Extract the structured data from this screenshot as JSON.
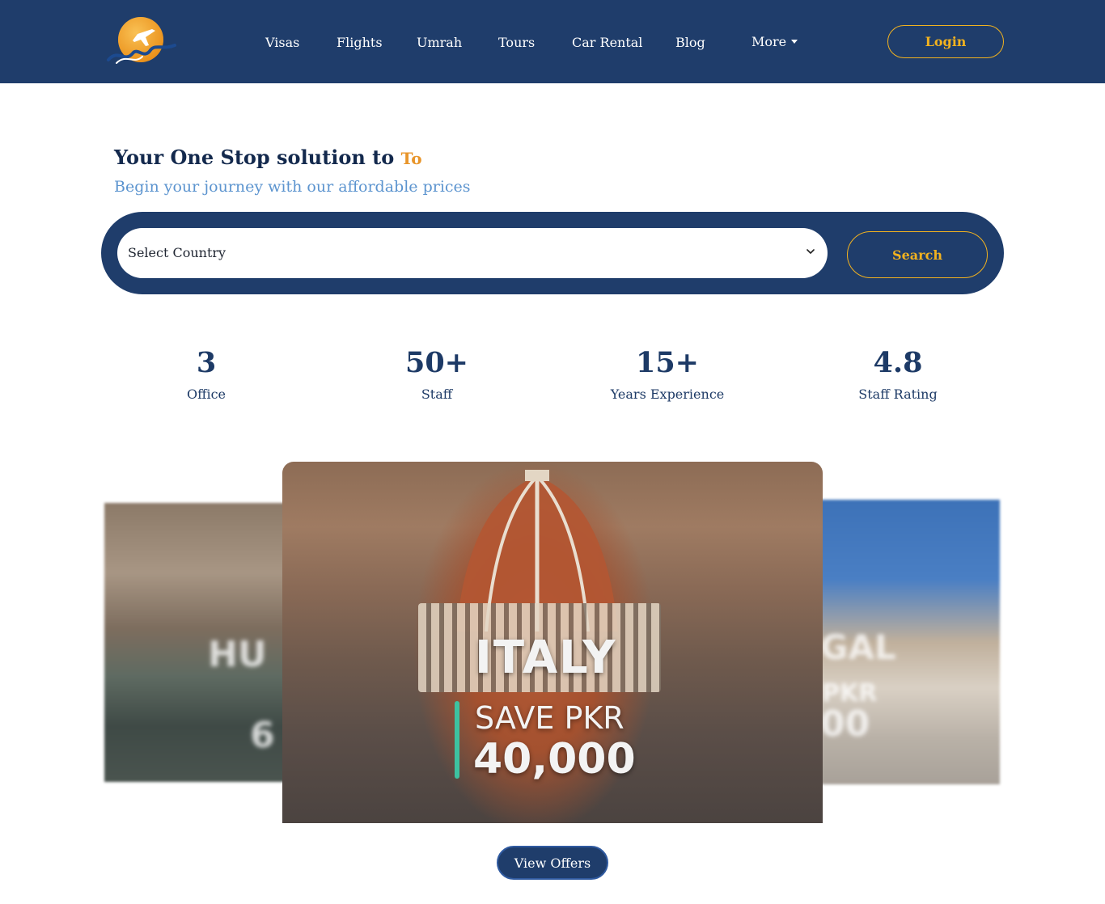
{
  "nav": {
    "items": [
      {
        "label": "Visas"
      },
      {
        "label": "Flights"
      },
      {
        "label": "Umrah"
      },
      {
        "label": "Tours"
      },
      {
        "label": "Car Rental"
      },
      {
        "label": "Blog"
      },
      {
        "label": "More"
      }
    ],
    "login_label": "Login"
  },
  "hero": {
    "title": "Your One Stop solution to",
    "title_accent": "To",
    "subtitle": "Begin your journey with our affordable prices"
  },
  "search": {
    "select_value": "Select Country",
    "button_label": "Search"
  },
  "stats": [
    {
      "value": "3",
      "label": "Office"
    },
    {
      "value": "50+",
      "label": "Staff"
    },
    {
      "value": "15+",
      "label": "Years Experience"
    },
    {
      "value": "4.8",
      "label": "Staff Rating"
    }
  ],
  "carousel": {
    "left_card": {
      "country": "HU",
      "amount": "6"
    },
    "main_card": {
      "country": "ITALY",
      "save_text": "SAVE PKR",
      "amount": "40,000"
    },
    "right_card": {
      "country": "GAL",
      "save_text": "PKR",
      "amount": "00"
    }
  },
  "view_offers_label": "View Offers",
  "colors": {
    "navy": "#1f3d6b",
    "gold": "#f2b21f",
    "accent_orange": "#e8952a",
    "subtitle_blue": "#5c94cf",
    "teal_bar": "#3dc2a0"
  }
}
